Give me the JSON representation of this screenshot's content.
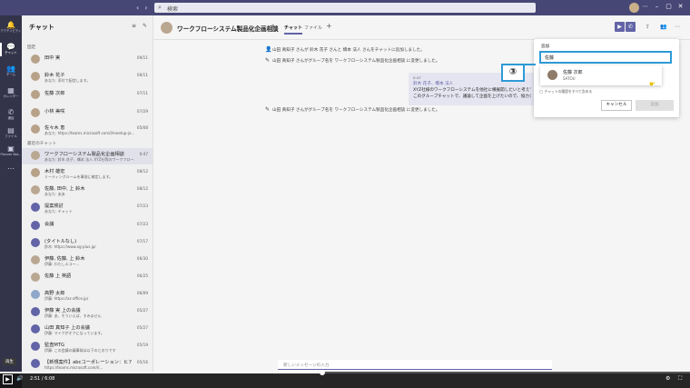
{
  "titlebar": {
    "search_placeholder": "検索"
  },
  "rail": {
    "items": [
      {
        "label": "アクティビティ",
        "icon": "bell-icon"
      },
      {
        "label": "チャット",
        "icon": "chat-icon"
      },
      {
        "label": "チーム",
        "icon": "teams-icon"
      },
      {
        "label": "カレンダー",
        "icon": "calendar-icon"
      },
      {
        "label": "通話",
        "icon": "phone-icon"
      },
      {
        "label": "ファイル",
        "icon": "file-icon"
      },
      {
        "label": "Planner Bot...",
        "icon": "planner-icon"
      },
      {
        "label": "…",
        "icon": "more-icon"
      }
    ]
  },
  "list": {
    "title": "チャット",
    "pinned_label": "固定",
    "recent_label": "最近のチャット",
    "pinned": [
      {
        "name": "田中 実",
        "preview": "",
        "date": "09/11"
      },
      {
        "name": "鈴木 花子",
        "preview": "あなた: 添付で配信します。",
        "date": "09/11"
      },
      {
        "name": "佐藤 次郎",
        "preview": "",
        "date": "07/11"
      },
      {
        "name": "小林 美咲",
        "preview": "",
        "date": "07/29"
      },
      {
        "name": "佐々木 恵",
        "preview": "あなた: https://teams.microsoft.com/l/meetup-jo...",
        "date": "05/08"
      }
    ],
    "recent": [
      {
        "name": "ワークフローシステム製品化企画相談",
        "preview": "あなた: 鈴木 花子、橋本 法人 XYZ社等のワークフロー...",
        "date": "0:47"
      },
      {
        "name": "木村 雄宏",
        "preview": "ミーティングルームを事前に確定します。",
        "date": "08/12"
      },
      {
        "name": "佐藤, 田中, 上 鈴木",
        "preview": "あなた: ああ",
        "date": "08/12"
      },
      {
        "name": "提案検討",
        "preview": "あなた: チャット",
        "date": "07/23"
      },
      {
        "name": "会議",
        "preview": "",
        "date": "07/23"
      },
      {
        "name": "(タイトルなし)",
        "preview": "鈴木: https://www.xg-plus.jp/",
        "date": "07/17"
      },
      {
        "name": "伊藤, 佐藤, 上 鈴木",
        "preview": "伊藤: わたしエコー...",
        "date": "06/30"
      },
      {
        "name": "佐藤 上 英語",
        "preview": "",
        "date": "06/25"
      },
      {
        "name": "高野 太郎",
        "preview": "伊藤: https://xz-office.jp/",
        "date": "06/09"
      },
      {
        "name": "伊藤 実 上の会議",
        "preview": "伊藤: あ、そういえば、すみません",
        "date": "05/27"
      },
      {
        "name": "山田 真知子 上の会議",
        "preview": "伊藤: マイクがオフになっています。",
        "date": "05/27"
      },
      {
        "name": "監査MTG",
        "preview": "伊藤: この会議の議事録は以下のとおりです",
        "date": "05/19"
      },
      {
        "name": "【新規案件】abcコーポレーション：ヒアリン...",
        "preview": "https://teams.microsoft.com/l/...",
        "date": "05/16"
      }
    ]
  },
  "main": {
    "chat_title": "ワークフローシステム製品化企画相談",
    "tabs": [
      {
        "label": "チャット"
      },
      {
        "label": "ファイル"
      }
    ],
    "messages": [
      {
        "icon": "person-add-icon",
        "text": "山田 真知子 さんが 鈴木 花子 さんと 橋本 法人 さんをチャットに追加しました。"
      },
      {
        "icon": "pencil-icon",
        "text": "山田 真知子 さんがグループ名を ワークフローシステム製品化企画相談 に変更しました。"
      },
      {
        "icon": "pencil-icon",
        "text": "山田 真知子 さんがグループ名を ワークフローシステム製品化企画相談 に変更しました。"
      }
    ],
    "bubble": {
      "time": "0:47",
      "recipients": "鈴木 花子、橋本 法人",
      "line1": "XYZ社様のワークフローシステムを他社に横展開したいと考えて",
      "line2": "このグループチャットで、議論して企画を上げたいので、協力して"
    },
    "compose_placeholder": "新しいメッセージの入力"
  },
  "popup": {
    "label": "追加",
    "input_value": "佐藤",
    "suggestion_name": "佐藤 次郎",
    "suggestion_sub": "SATOU",
    "history_text": "チャットの履歴をすべて含める",
    "cancel_label": "キャンセル",
    "add_label": "追加",
    "callout": "③"
  },
  "video": {
    "time": "2:51 / 6:08",
    "tooltip": "再生",
    "progress": 0.467
  },
  "colors": {
    "accent": "#6264a7",
    "titlebar": "#464775",
    "highlight": "#2d9ad6"
  }
}
